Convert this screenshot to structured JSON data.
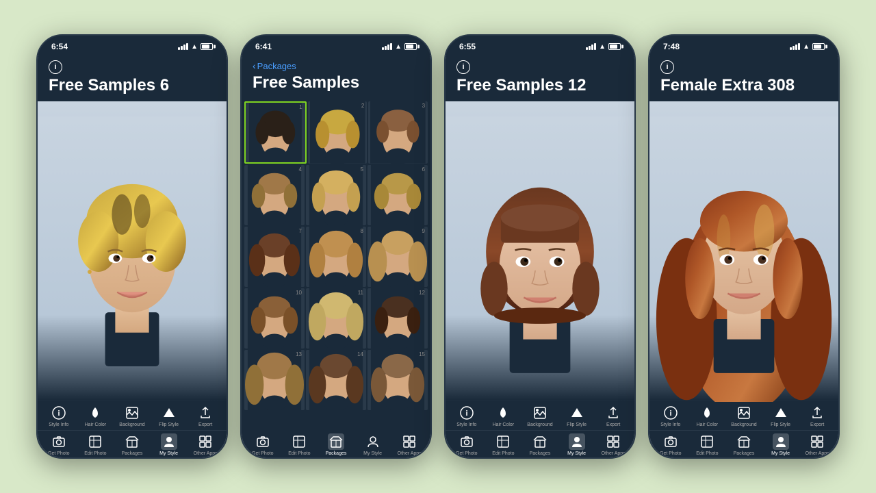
{
  "background_color": "#d8e8c8",
  "phones": [
    {
      "id": "phone1",
      "time": "6:54",
      "title": "Free Samples 6",
      "has_info_icon": true,
      "has_back": false,
      "view": "detail",
      "bottom_nav_active_top": "",
      "bottom_nav_active_bottom": "My Style",
      "toolbar_top": [
        "Style Info",
        "Hair Color",
        "Background",
        "Flip Style",
        "Export"
      ],
      "toolbar_bottom": [
        "Get Photo",
        "Edit Photo",
        "Packages",
        "My Style",
        "Other Apps"
      ],
      "active_bottom": "My Style"
    },
    {
      "id": "phone2",
      "time": "6:41",
      "title": "Free Samples",
      "has_info_icon": false,
      "has_back": true,
      "back_label": "Packages",
      "view": "grid",
      "toolbar_bottom": [
        "Get Photo",
        "Edit Photo",
        "Packages",
        "My Style",
        "Other Apps"
      ],
      "active_bottom": "Packages",
      "grid_count": 15
    },
    {
      "id": "phone3",
      "time": "6:55",
      "title": "Free Samples 12",
      "has_info_icon": true,
      "has_back": false,
      "view": "detail",
      "toolbar_top": [
        "Style Info",
        "Hair Color",
        "Background",
        "Flip Style",
        "Export"
      ],
      "toolbar_bottom": [
        "Get Photo",
        "Edit Photo",
        "Packages",
        "My Style",
        "Other Apps"
      ],
      "active_bottom": "My Style"
    },
    {
      "id": "phone4",
      "time": "7:48",
      "title": "Female Extra 308",
      "has_info_icon": true,
      "has_back": false,
      "view": "detail",
      "toolbar_top": [
        "Style Info",
        "Hair Color",
        "Background",
        "Flip Style",
        "Export"
      ],
      "toolbar_bottom": [
        "Get Photo",
        "Edit Photo",
        "Packages",
        "My Style",
        "Other Apps"
      ],
      "active_bottom": "My Style"
    }
  ],
  "toolbar_icons": {
    "Style Info": "ℹ",
    "Hair Color": "🪣",
    "Background": "🖼",
    "Flip Style": "⛵",
    "Export": "↗",
    "Get Photo": "📷",
    "Edit Photo": "⊞",
    "Packages": "📦",
    "My Style": "👤",
    "Other Apps": "⬜"
  }
}
